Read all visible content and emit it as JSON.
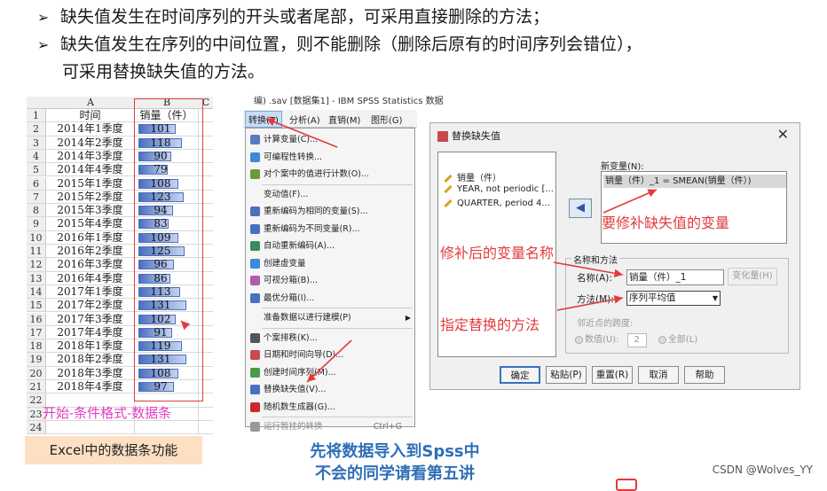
{
  "bullets": [
    "缺失值发生在时间序列的开头或者尾部，可采用直接删除的方法；",
    "缺失值发生在序列的中间位置，则不能删除（删除后原有的时间序列会错位），",
    "可采用替换缺失值的方法。"
  ],
  "excel": {
    "col_a": "A",
    "col_b": "B",
    "col_c": "C",
    "header_time": "时间",
    "header_sales": "销量（件）",
    "rows": [
      {
        "n": "2",
        "t": "2014年1季度",
        "v": 101
      },
      {
        "n": "3",
        "t": "2014年2季度",
        "v": 118
      },
      {
        "n": "4",
        "t": "2014年3季度",
        "v": 90
      },
      {
        "n": "5",
        "t": "2014年4季度",
        "v": 79
      },
      {
        "n": "6",
        "t": "2015年1季度",
        "v": 108
      },
      {
        "n": "7",
        "t": "2015年2季度",
        "v": 123
      },
      {
        "n": "8",
        "t": "2015年3季度",
        "v": 94
      },
      {
        "n": "9",
        "t": "2015年4季度",
        "v": 83
      },
      {
        "n": "10",
        "t": "2016年1季度",
        "v": 109
      },
      {
        "n": "11",
        "t": "2016年2季度",
        "v": 125
      },
      {
        "n": "12",
        "t": "2016年3季度",
        "v": 96
      },
      {
        "n": "13",
        "t": "2016年4季度",
        "v": 86
      },
      {
        "n": "14",
        "t": "2017年1季度",
        "v": 113
      },
      {
        "n": "15",
        "t": "2017年2季度",
        "v": 131
      },
      {
        "n": "16",
        "t": "2017年3季度",
        "v": 102
      },
      {
        "n": "17",
        "t": "2017年4季度",
        "v": 91
      },
      {
        "n": "18",
        "t": "2018年1季度",
        "v": 119
      },
      {
        "n": "19",
        "t": "2018年2季度",
        "v": 131
      },
      {
        "n": "20",
        "t": "2018年3季度",
        "v": 108
      },
      {
        "n": "21",
        "t": "2018年4季度",
        "v": 97
      }
    ],
    "row1": "1",
    "row22": "22",
    "row23": "23",
    "row24": "24",
    "note": "开始-条件格式-数据条",
    "caption": "Excel中的数据条功能",
    "bar_color": "#4a6fbf"
  },
  "spss": {
    "title": "编) .sav [数据集1] - IBM SPSS Statistics 数据",
    "menubar": [
      "转换(T)",
      "分析(A)",
      "直销(M)",
      "图形(G)"
    ],
    "items": [
      {
        "label": "计算变量(C)...",
        "icon": "calculator-icon",
        "color": "#5a7bbf"
      },
      {
        "label": "可编程性转换...",
        "icon": "plus-icon",
        "color": "#3a8bd8"
      },
      {
        "label": "对个案中的值进行计数(O)...",
        "icon": "count-icon",
        "color": "#6a9a3a"
      },
      {
        "label": "变动值(F)...",
        "icon": "",
        "color": ""
      },
      {
        "label": "重新编码为相同的变量(S)...",
        "icon": "recode-same-icon",
        "color": "#4a6fbf"
      },
      {
        "label": "重新编码为不同变量(R)...",
        "icon": "recode-diff-icon",
        "color": "#4a6fbf"
      },
      {
        "label": "自动重新编码(A)...",
        "icon": "auto-recode-icon",
        "color": "#3a8a5a"
      },
      {
        "label": "创建虚变量",
        "icon": "dummy-var-icon",
        "color": "#3a8bd8"
      },
      {
        "label": "可视分箱(B)...",
        "icon": "binning-icon",
        "color": "#b05ab0"
      },
      {
        "label": "最优分箱(I)...",
        "icon": "optimal-binning-icon",
        "color": "#4a6fbf"
      },
      {
        "label": "准备数据以进行建模(P)",
        "icon": "",
        "color": ""
      },
      {
        "label": "个案排秩(K)...",
        "icon": "rank-icon",
        "color": "#555"
      },
      {
        "label": "日期和时间向导(D)...",
        "icon": "date-icon",
        "color": "#c84a4a"
      },
      {
        "label": "创建时间序列(M)...",
        "icon": "time-series-icon",
        "color": "#4a9a4a"
      },
      {
        "label": "替换缺失值(V)...",
        "icon": "replace-missing-icon",
        "color": "#4a6fbf"
      },
      {
        "label": "随机数生成器(G)...",
        "icon": "dice-icon",
        "color": "#c82a2a"
      },
      {
        "label": "运行暂挂的转换",
        "icon": "run-icon",
        "color": "#999",
        "shortcut": "Ctrl+G"
      }
    ],
    "caption_line1": "先将数据导入到Spss中",
    "caption_line2": "不会的同学请看第五讲"
  },
  "dialog": {
    "title": "替换缺失值",
    "variables": [
      "销量（件）",
      "YEAR, not periodic [...",
      "QUARTER, period 4..."
    ],
    "new_var_label": "新变量(N):",
    "new_var_value": "销量（件）_1 = SMEAN(销量（件）)",
    "group_label": "名称和方法",
    "name_label": "名称(A):",
    "name_value": "销量（件）_1",
    "change_btn": "变化量(H)",
    "method_label": "方法(M):",
    "method_value": "序列平均值",
    "span_label": "邻近点的跨度:",
    "span_number_label": "数值(U):",
    "span_number_value": "2",
    "span_all_label": "全部(L)",
    "buttons": [
      "确定",
      "粘贴(P)",
      "重置(R)",
      "取消",
      "帮助"
    ]
  },
  "annotations": {
    "fix_var": "要修补缺失值的变量",
    "new_name": "修补后的变量名称",
    "method": "指定替换的方法",
    "color": "#e23b3b"
  },
  "watermark": "CSDN @Wolves_YY"
}
